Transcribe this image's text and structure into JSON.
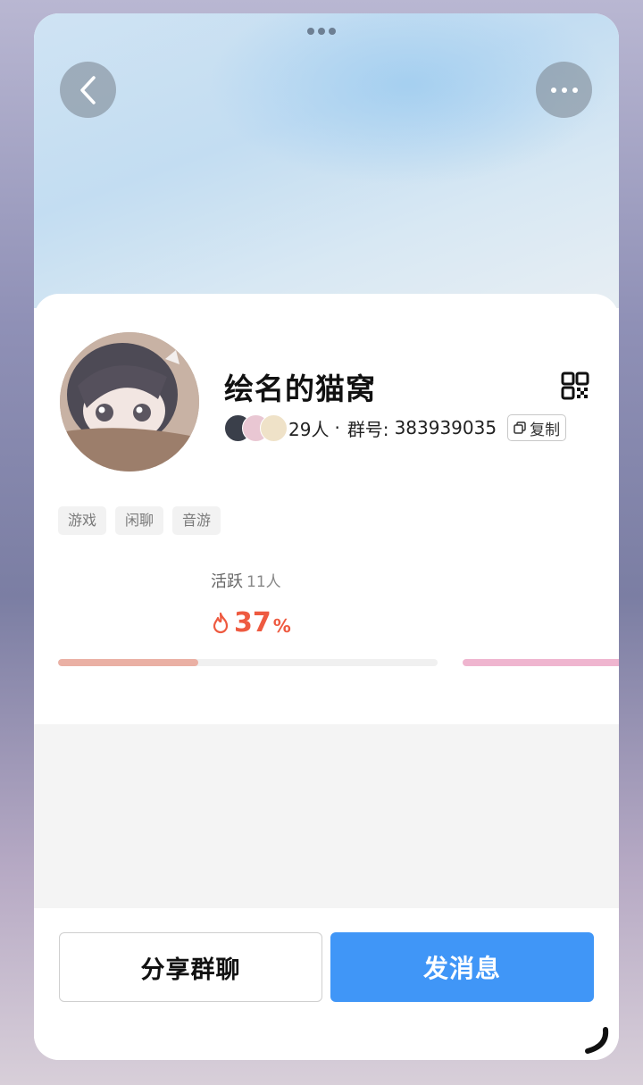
{
  "group": {
    "name": "绘名的猫窝",
    "members": "29人",
    "separator": "·",
    "id_label": "群号:",
    "id": "383939035",
    "copy_label": "复制"
  },
  "tags": [
    "游戏",
    "闲聊",
    "音游"
  ],
  "activity": {
    "label": "活跃",
    "count": "11人",
    "percent_value": "37",
    "percent_sign": "%",
    "progress": 0.37
  },
  "buttons": {
    "share": "分享群聊",
    "send": "发消息"
  },
  "colors": {
    "accent": "#4096f7",
    "fire": "#ee5a40",
    "progress_fill": "#eab0a4",
    "secondary_progress": "#efb5cf"
  }
}
